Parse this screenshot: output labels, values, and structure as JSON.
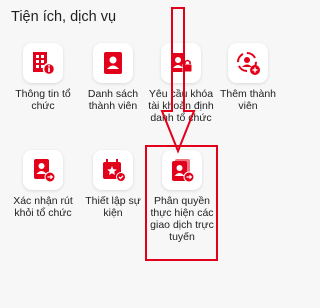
{
  "section": {
    "title": "Tiện ích, dịch vụ"
  },
  "colors": {
    "accent": "#e2001a",
    "tile_bg": "#ffffff"
  },
  "tiles": [
    {
      "label": "Thông tin tổ chức",
      "icon": "building-info-icon"
    },
    {
      "label": "Danh sách thành viên",
      "icon": "member-list-icon"
    },
    {
      "label": "Yêu cầu khóa tài khoản định danh tổ chức",
      "icon": "account-lock-icon"
    },
    {
      "label": "Thêm thành viên",
      "icon": "add-member-icon"
    },
    {
      "label": "Xác nhận rút khỏi tổ chức",
      "icon": "leave-org-icon"
    },
    {
      "label": "Thiết lập sự kiện",
      "icon": "calendar-star-icon"
    },
    {
      "label": "Phân quyền thực hiện các giao dịch trực tuyến",
      "icon": "delegate-transaction-icon"
    }
  ]
}
